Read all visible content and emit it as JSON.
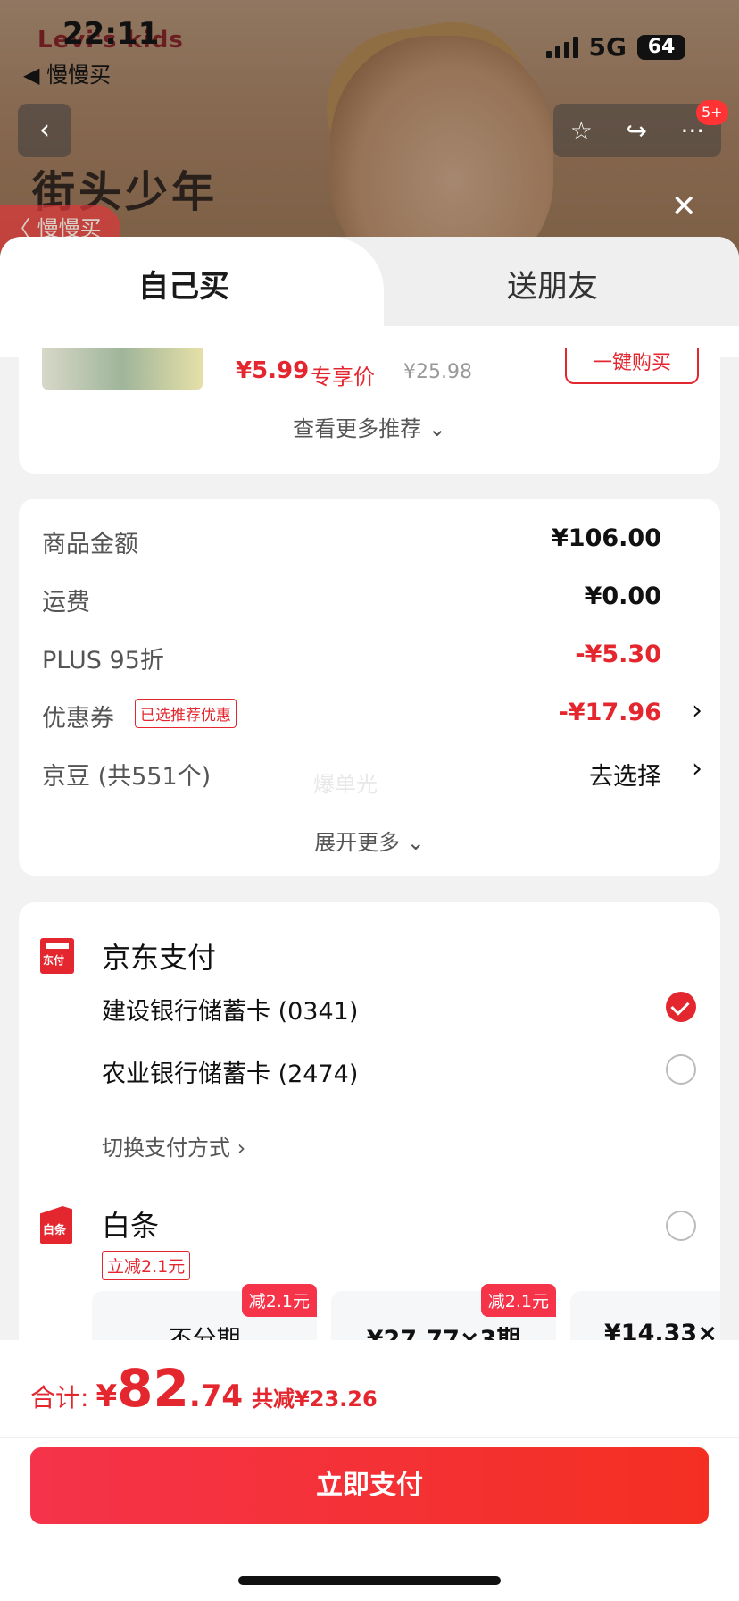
{
  "status_bar": {
    "time": "22:11",
    "back_app": "◀ 慢慢买",
    "network": "5G",
    "battery": "64"
  },
  "background": {
    "brand": "Levi's kids",
    "hero_title": "街头少年",
    "chip": "〈 慢慢买",
    "badge": "5+",
    "icons": [
      "back-icon",
      "star-icon",
      "share-icon",
      "more-icon",
      "close-icon"
    ]
  },
  "tabs": {
    "self": "自己买",
    "friend": "送朋友"
  },
  "recommend": {
    "price": "¥5.99",
    "price_tag": "专享价",
    "original": "¥25.98",
    "buy_label": "一键购买",
    "more_label": "查看更多推荐"
  },
  "summary": {
    "rows": [
      {
        "label": "商品金额",
        "value": "¥106.00"
      },
      {
        "label": "运费",
        "value": "¥0.00"
      },
      {
        "label": "PLUS 95折",
        "value": "-¥5.30"
      },
      {
        "label": "优惠券",
        "tag": "已选推荐优惠",
        "value": "-¥17.96"
      },
      {
        "label": "京豆 (共551个)",
        "value": "去选择"
      }
    ],
    "watermark": "爆单光",
    "expand_label": "展开更多"
  },
  "payment": {
    "jd_title": "京东支付",
    "jd_icon_label": "东付",
    "cards": [
      {
        "label": "建设银行储蓄卡 (0341)",
        "selected": true
      },
      {
        "label": "农业银行储蓄卡 (2474)",
        "selected": false
      }
    ],
    "switch_label": "切换支付方式 ›",
    "baitiao_title": "白条",
    "baitiao_icon_label": "白条",
    "baitiao_tag": "立减2.1元",
    "plans": [
      {
        "label": "不分期",
        "badge": "减2.1元"
      },
      {
        "label": "¥27.77×3期",
        "badge": "减2.1元"
      },
      {
        "label": "¥14.33×"
      }
    ]
  },
  "footer": {
    "total_label": "合计:",
    "currency": "¥",
    "total_int": "82",
    "total_dec": ".74",
    "saved": "共减¥23.26",
    "pay_button": "立即支付"
  },
  "colors": {
    "accent": "#e4272f",
    "button_start": "#f5334a",
    "button_end": "#f42f22"
  }
}
